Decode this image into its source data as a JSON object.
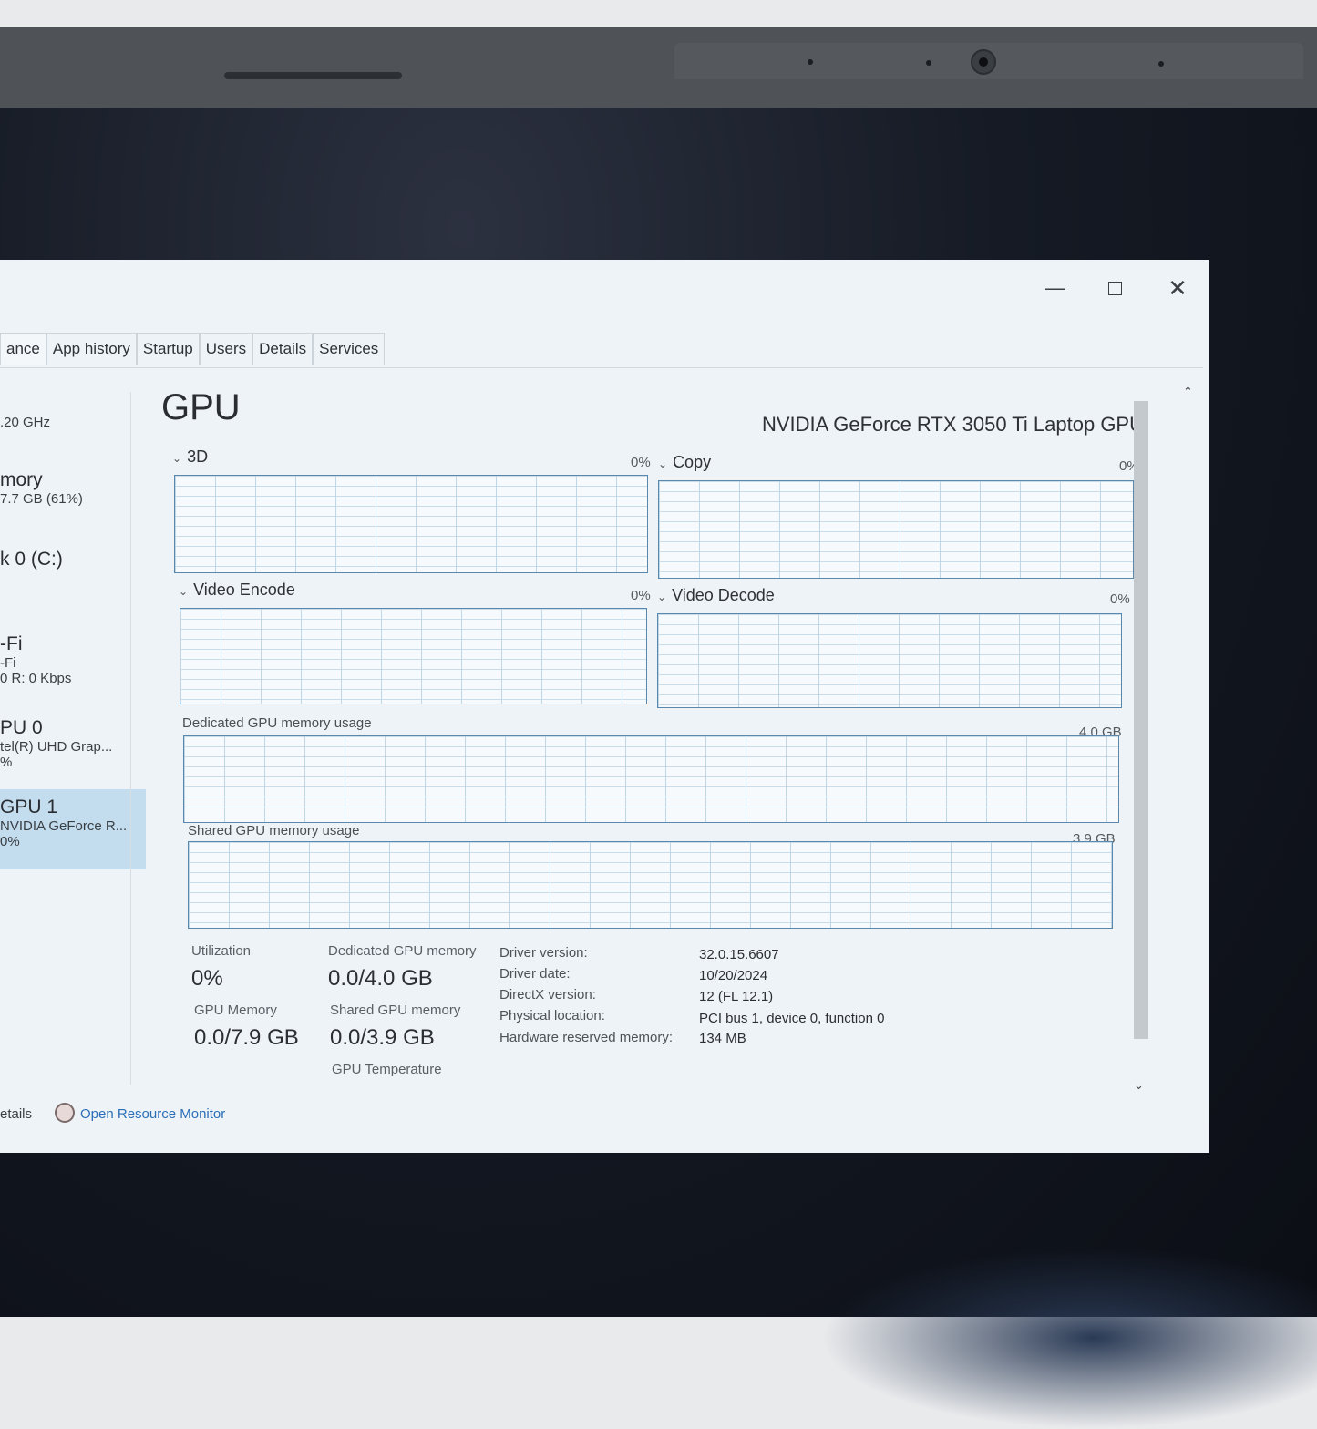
{
  "window": {
    "controls": {
      "minimize": "—",
      "maximize": "",
      "close": "✕"
    }
  },
  "tabs": [
    {
      "label": "ance"
    },
    {
      "label": "App history"
    },
    {
      "label": "Startup"
    },
    {
      "label": "Users"
    },
    {
      "label": "Details"
    },
    {
      "label": "Services"
    }
  ],
  "sidebar": {
    "items": [
      {
        "title": "",
        "sub": ".20 GHz"
      },
      {
        "title": "mory",
        "sub": "7.7 GB (61%)"
      },
      {
        "title": "k 0 (C:)",
        "sub": ""
      },
      {
        "title": "-Fi",
        "sub": "-Fi",
        "sub2": "0 R: 0 Kbps"
      },
      {
        "title": "PU 0",
        "sub": "tel(R) UHD Grap...",
        "sub2": "%"
      },
      {
        "title": "GPU 1",
        "sub": "NVIDIA GeForce R...",
        "sub2": "0%"
      }
    ]
  },
  "main": {
    "title": "GPU",
    "gpu_name": "NVIDIA GeForce RTX 3050 Ti Laptop GPU",
    "engines": [
      {
        "label": "3D",
        "pct": "0%"
      },
      {
        "label": "Copy",
        "pct": "0%"
      },
      {
        "label": "Video Encode",
        "pct": "0%"
      },
      {
        "label": "Video Decode",
        "pct": "0%"
      }
    ],
    "dedicated_mem": {
      "label": "Dedicated GPU memory usage",
      "max": "4.0 GB"
    },
    "shared_mem": {
      "label": "Shared GPU memory usage",
      "max": "3.9 GB"
    },
    "stats": {
      "utilization_label": "Utilization",
      "utilization_value": "0%",
      "dedicated_label": "Dedicated GPU memory",
      "dedicated_value": "0.0/4.0 GB",
      "gpu_memory_label": "GPU Memory",
      "gpu_memory_value": "0.0/7.9 GB",
      "shared_label": "Shared GPU memory",
      "shared_value": "0.0/3.9 GB",
      "temp_label": "GPU Temperature"
    },
    "info": [
      {
        "key": "Driver version:",
        "value": "32.0.15.6607"
      },
      {
        "key": "Driver date:",
        "value": "10/20/2024"
      },
      {
        "key": "DirectX version:",
        "value": "12 (FL 12.1)"
      },
      {
        "key": "Physical location:",
        "value": "PCI bus 1, device 0, function 0"
      },
      {
        "key": "Hardware reserved memory:",
        "value": "134 MB"
      }
    ]
  },
  "footer": {
    "fewer_details": "etails",
    "resource_monitor": "Open Resource Monitor"
  },
  "scroll": {
    "up": "⌃",
    "down": "⌄"
  }
}
